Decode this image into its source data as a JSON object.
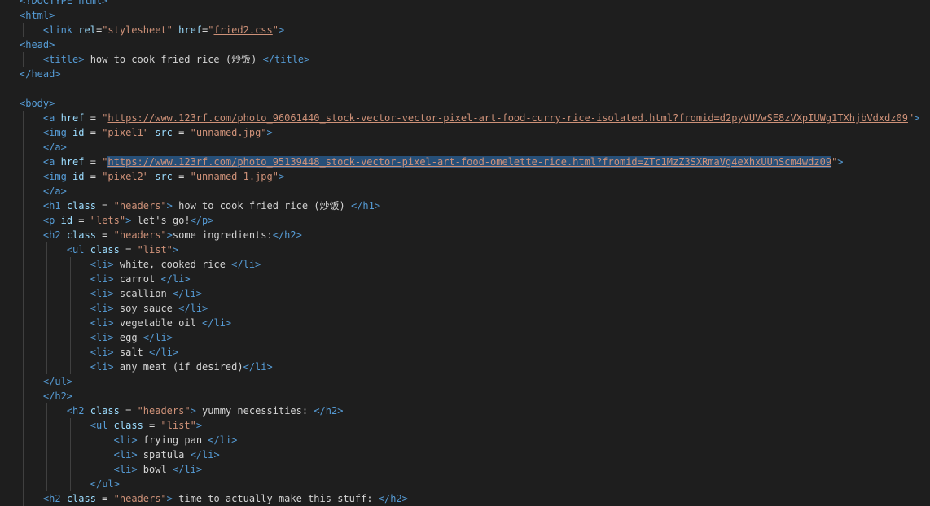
{
  "editor": {
    "language": "html",
    "lines": [
      {
        "indent": 0,
        "parts": [
          {
            "c": "t",
            "v": "<!DOCTYPE html>"
          }
        ]
      },
      {
        "indent": 0,
        "parts": [
          {
            "c": "t",
            "v": "<html>"
          }
        ]
      },
      {
        "indent": 1,
        "parts": [
          {
            "c": "t",
            "v": "<link"
          },
          {
            "c": "tx",
            "v": " "
          },
          {
            "c": "a",
            "v": "rel"
          },
          {
            "c": "tx",
            "v": "="
          },
          {
            "c": "s",
            "v": "\"stylesheet\""
          },
          {
            "c": "tx",
            "v": " "
          },
          {
            "c": "a",
            "v": "href"
          },
          {
            "c": "tx",
            "v": "="
          },
          {
            "c": "s",
            "v": "\""
          },
          {
            "c": "u",
            "v": "fried2.css"
          },
          {
            "c": "s",
            "v": "\""
          },
          {
            "c": "t",
            "v": ">"
          }
        ]
      },
      {
        "indent": 0,
        "parts": [
          {
            "c": "t",
            "v": "<head>"
          }
        ]
      },
      {
        "indent": 1,
        "parts": [
          {
            "c": "t",
            "v": "<title>"
          },
          {
            "c": "tx",
            "v": " how to cook fried rice (炒饭) "
          },
          {
            "c": "t",
            "v": "</title>"
          }
        ]
      },
      {
        "indent": 0,
        "parts": [
          {
            "c": "t",
            "v": "</head>"
          }
        ]
      },
      {
        "indent": 0,
        "parts": []
      },
      {
        "indent": 0,
        "parts": [
          {
            "c": "t",
            "v": "<body>"
          }
        ]
      },
      {
        "indent": 1,
        "parts": [
          {
            "c": "t",
            "v": "<a"
          },
          {
            "c": "tx",
            "v": " "
          },
          {
            "c": "a",
            "v": "href"
          },
          {
            "c": "tx",
            "v": " = "
          },
          {
            "c": "s",
            "v": "\""
          },
          {
            "c": "u",
            "v": "https://www.123rf.com/photo_96061440_stock-vector-vector-pixel-art-food-curry-rice-isolated.html?fromid=d2pyVUVwSE8zVXpIUWg1TXhjbVdxdz09"
          },
          {
            "c": "s",
            "v": "\""
          },
          {
            "c": "t",
            "v": ">"
          }
        ]
      },
      {
        "indent": 1,
        "parts": [
          {
            "c": "t",
            "v": "<img"
          },
          {
            "c": "tx",
            "v": " "
          },
          {
            "c": "a",
            "v": "id"
          },
          {
            "c": "tx",
            "v": " = "
          },
          {
            "c": "s",
            "v": "\"pixel1\""
          },
          {
            "c": "tx",
            "v": " "
          },
          {
            "c": "a",
            "v": "src"
          },
          {
            "c": "tx",
            "v": " = "
          },
          {
            "c": "s",
            "v": "\""
          },
          {
            "c": "u",
            "v": "unnamed.jpg"
          },
          {
            "c": "s",
            "v": "\""
          },
          {
            "c": "t",
            "v": ">"
          }
        ]
      },
      {
        "indent": 1,
        "parts": [
          {
            "c": "t",
            "v": "</a>"
          }
        ]
      },
      {
        "indent": 1,
        "parts": [
          {
            "c": "t",
            "v": "<a"
          },
          {
            "c": "tx",
            "v": " "
          },
          {
            "c": "a",
            "v": "href"
          },
          {
            "c": "tx",
            "v": " = "
          },
          {
            "c": "s",
            "v": "\""
          },
          {
            "c": "u",
            "v": "https://www.123rf.com/photo_95139448_stock-vector-pixel-art-food-omelette-rice.html?fromid=ZTc1MzZ3SXRmaVg4eXhxUUhScm4wdz09",
            "sel": true
          },
          {
            "c": "s",
            "v": "\""
          },
          {
            "c": "t",
            "v": ">"
          }
        ]
      },
      {
        "indent": 1,
        "parts": [
          {
            "c": "t",
            "v": "<img"
          },
          {
            "c": "tx",
            "v": " "
          },
          {
            "c": "a",
            "v": "id"
          },
          {
            "c": "tx",
            "v": " = "
          },
          {
            "c": "s",
            "v": "\"pixel2\""
          },
          {
            "c": "tx",
            "v": " "
          },
          {
            "c": "a",
            "v": "src"
          },
          {
            "c": "tx",
            "v": " = "
          },
          {
            "c": "s",
            "v": "\""
          },
          {
            "c": "u",
            "v": "unnamed-1.jpg"
          },
          {
            "c": "s",
            "v": "\""
          },
          {
            "c": "t",
            "v": ">"
          }
        ]
      },
      {
        "indent": 1,
        "parts": [
          {
            "c": "t",
            "v": "</a>"
          }
        ]
      },
      {
        "indent": 1,
        "parts": [
          {
            "c": "t",
            "v": "<h1"
          },
          {
            "c": "tx",
            "v": " "
          },
          {
            "c": "a",
            "v": "class"
          },
          {
            "c": "tx",
            "v": " = "
          },
          {
            "c": "s",
            "v": "\"headers\""
          },
          {
            "c": "t",
            "v": ">"
          },
          {
            "c": "tx",
            "v": " how to cook fried rice (炒饭) "
          },
          {
            "c": "t",
            "v": "</h1>"
          }
        ]
      },
      {
        "indent": 1,
        "parts": [
          {
            "c": "t",
            "v": "<p"
          },
          {
            "c": "tx",
            "v": " "
          },
          {
            "c": "a",
            "v": "id"
          },
          {
            "c": "tx",
            "v": " = "
          },
          {
            "c": "s",
            "v": "\"lets\""
          },
          {
            "c": "t",
            "v": ">"
          },
          {
            "c": "tx",
            "v": " let's go!"
          },
          {
            "c": "t",
            "v": "</p>"
          }
        ]
      },
      {
        "indent": 1,
        "parts": [
          {
            "c": "t",
            "v": "<h2"
          },
          {
            "c": "tx",
            "v": " "
          },
          {
            "c": "a",
            "v": "class"
          },
          {
            "c": "tx",
            "v": " = "
          },
          {
            "c": "s",
            "v": "\"headers\""
          },
          {
            "c": "t",
            "v": ">"
          },
          {
            "c": "tx",
            "v": "some ingredients:"
          },
          {
            "c": "t",
            "v": "</h2>"
          }
        ]
      },
      {
        "indent": 2,
        "parts": [
          {
            "c": "t",
            "v": "<ul"
          },
          {
            "c": "tx",
            "v": " "
          },
          {
            "c": "a",
            "v": "class"
          },
          {
            "c": "tx",
            "v": " = "
          },
          {
            "c": "s",
            "v": "\"list\""
          },
          {
            "c": "t",
            "v": ">"
          }
        ]
      },
      {
        "indent": 3,
        "parts": [
          {
            "c": "t",
            "v": "<li>"
          },
          {
            "c": "tx",
            "v": " white, cooked rice "
          },
          {
            "c": "t",
            "v": "</li>"
          }
        ]
      },
      {
        "indent": 3,
        "parts": [
          {
            "c": "t",
            "v": "<li>"
          },
          {
            "c": "tx",
            "v": " carrot "
          },
          {
            "c": "t",
            "v": "</li>"
          }
        ]
      },
      {
        "indent": 3,
        "parts": [
          {
            "c": "t",
            "v": "<li>"
          },
          {
            "c": "tx",
            "v": " scallion "
          },
          {
            "c": "t",
            "v": "</li>"
          }
        ]
      },
      {
        "indent": 3,
        "parts": [
          {
            "c": "t",
            "v": "<li>"
          },
          {
            "c": "tx",
            "v": " soy sauce "
          },
          {
            "c": "t",
            "v": "</li>"
          }
        ]
      },
      {
        "indent": 3,
        "parts": [
          {
            "c": "t",
            "v": "<li>"
          },
          {
            "c": "tx",
            "v": " vegetable oil "
          },
          {
            "c": "t",
            "v": "</li>"
          }
        ]
      },
      {
        "indent": 3,
        "parts": [
          {
            "c": "t",
            "v": "<li>"
          },
          {
            "c": "tx",
            "v": " egg "
          },
          {
            "c": "t",
            "v": "</li>"
          }
        ]
      },
      {
        "indent": 3,
        "parts": [
          {
            "c": "t",
            "v": "<li>"
          },
          {
            "c": "tx",
            "v": " salt "
          },
          {
            "c": "t",
            "v": "</li>"
          }
        ]
      },
      {
        "indent": 3,
        "parts": [
          {
            "c": "t",
            "v": "<li>"
          },
          {
            "c": "tx",
            "v": " any meat (if desired)"
          },
          {
            "c": "t",
            "v": "</li>"
          }
        ]
      },
      {
        "indent": 1,
        "parts": [
          {
            "c": "t",
            "v": "</ul>"
          }
        ]
      },
      {
        "indent": 1,
        "parts": [
          {
            "c": "t",
            "v": "</h2>"
          }
        ]
      },
      {
        "indent": 2,
        "parts": [
          {
            "c": "t",
            "v": "<h2"
          },
          {
            "c": "tx",
            "v": " "
          },
          {
            "c": "a",
            "v": "class"
          },
          {
            "c": "tx",
            "v": " = "
          },
          {
            "c": "s",
            "v": "\"headers\""
          },
          {
            "c": "t",
            "v": ">"
          },
          {
            "c": "tx",
            "v": " yummy necessities: "
          },
          {
            "c": "t",
            "v": "</h2>"
          }
        ]
      },
      {
        "indent": 3,
        "parts": [
          {
            "c": "t",
            "v": "<ul"
          },
          {
            "c": "tx",
            "v": " "
          },
          {
            "c": "a",
            "v": "class"
          },
          {
            "c": "tx",
            "v": " = "
          },
          {
            "c": "s",
            "v": "\"list\""
          },
          {
            "c": "t",
            "v": ">"
          }
        ]
      },
      {
        "indent": 4,
        "parts": [
          {
            "c": "t",
            "v": "<li>"
          },
          {
            "c": "tx",
            "v": " frying pan "
          },
          {
            "c": "t",
            "v": "</li>"
          }
        ]
      },
      {
        "indent": 4,
        "parts": [
          {
            "c": "t",
            "v": "<li>"
          },
          {
            "c": "tx",
            "v": " spatula "
          },
          {
            "c": "t",
            "v": "</li>"
          }
        ]
      },
      {
        "indent": 4,
        "parts": [
          {
            "c": "t",
            "v": "<li>"
          },
          {
            "c": "tx",
            "v": " bowl "
          },
          {
            "c": "t",
            "v": "</li>"
          }
        ]
      },
      {
        "indent": 3,
        "parts": [
          {
            "c": "t",
            "v": "</ul>"
          }
        ]
      },
      {
        "indent": 1,
        "parts": [
          {
            "c": "t",
            "v": "<h2"
          },
          {
            "c": "tx",
            "v": " "
          },
          {
            "c": "a",
            "v": "class"
          },
          {
            "c": "tx",
            "v": " = "
          },
          {
            "c": "s",
            "v": "\"headers\""
          },
          {
            "c": "t",
            "v": ">"
          },
          {
            "c": "tx",
            "v": " time to actually make this stuff: "
          },
          {
            "c": "t",
            "v": "</h2>"
          }
        ]
      }
    ]
  }
}
